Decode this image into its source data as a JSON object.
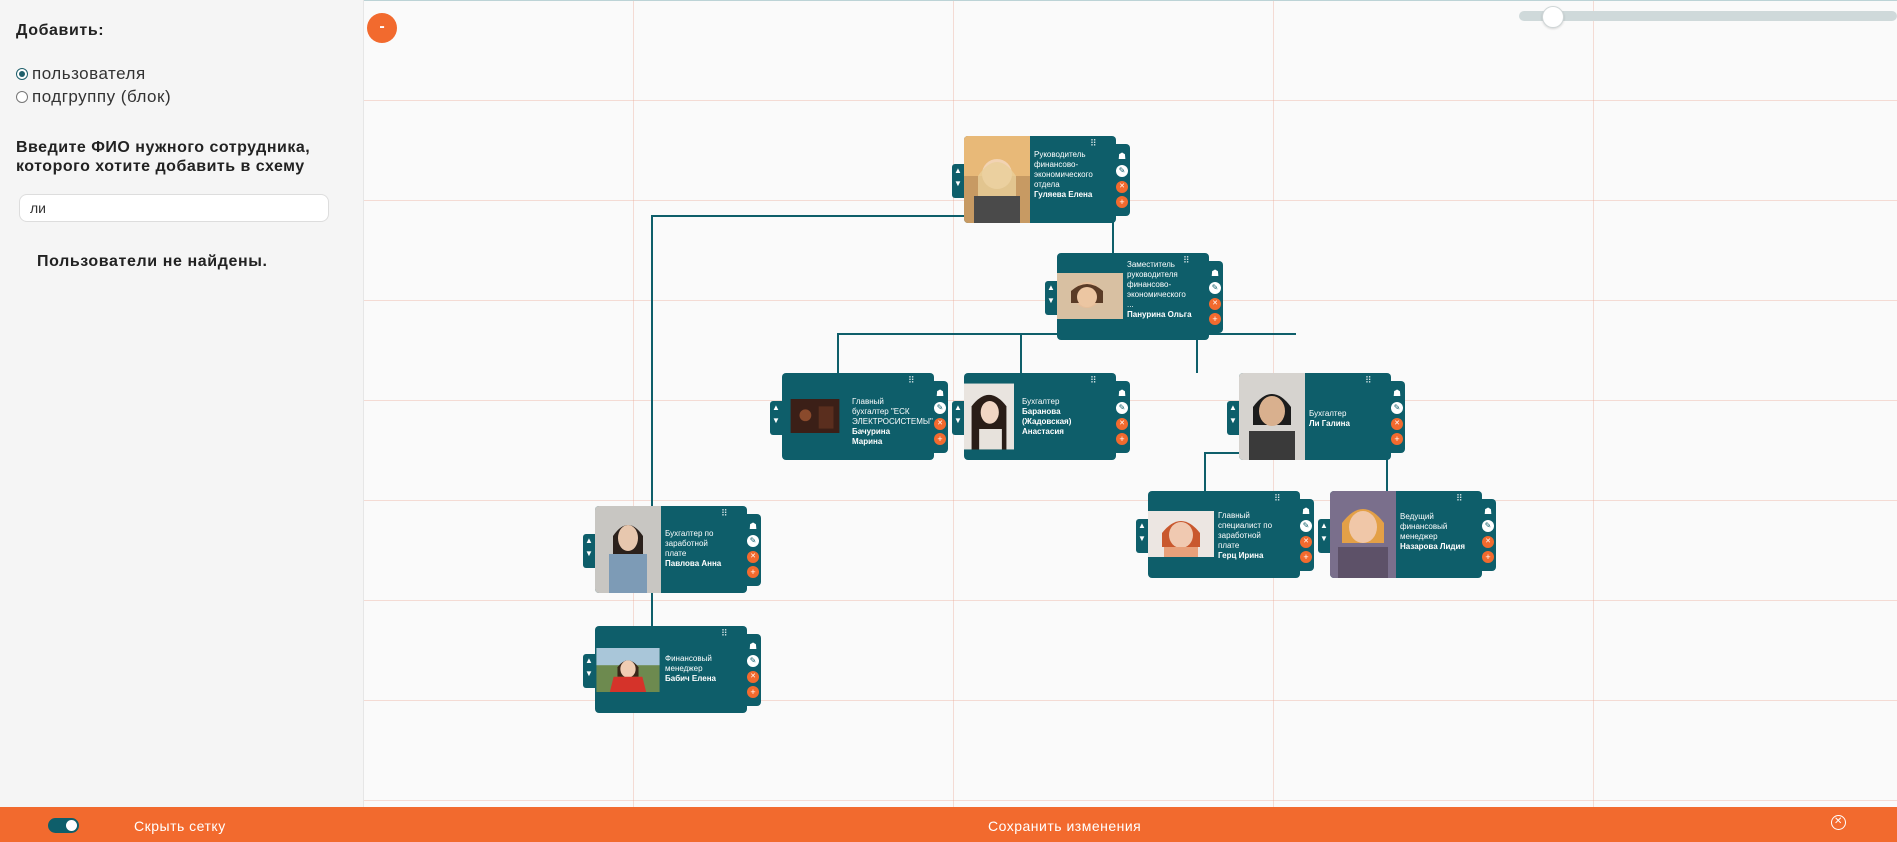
{
  "sidebar": {
    "title": "Добавить:",
    "options": [
      {
        "label": "пользователя",
        "checked": true
      },
      {
        "label": "подгруппу (блок)",
        "checked": false
      }
    ],
    "prompt": "Введите ФИО нужного сотрудника, которого хотите добавить в схему",
    "search_value": "ли",
    "empty_message": "Пользователи не найдены."
  },
  "toolbar": {
    "zoom_out_label": "-",
    "zoom_level": 0.42
  },
  "cards": [
    {
      "id": "gulyaeva",
      "position": "Руководитель финансово-экономического отдела",
      "name": "Гуляева Елена",
      "photo": "blonde-woman"
    },
    {
      "id": "panurina",
      "position": "Заместитель руководителя финансово-экономического ...",
      "name": "Панурина Ольга",
      "photo": "smiling-woman"
    },
    {
      "id": "bachurina",
      "position": "Главный бухгалтер \"ЕСК ЭЛЕКТРОСИСТЕМЫ\"",
      "name": "Бачурина Марина",
      "photo": "dark-photo"
    },
    {
      "id": "baranova",
      "position": "Бухгалтер",
      "name": "Баранова (Жадовская) Анастасия",
      "photo": "dark-hair-woman"
    },
    {
      "id": "li",
      "position": "Бухгалтер",
      "name": "Ли Галина",
      "photo": "woman-portrait"
    },
    {
      "id": "pavlova",
      "position": "Бухгалтер по заработной плате",
      "name": "Павлова Анна",
      "photo": "office-woman"
    },
    {
      "id": "gerts",
      "position": "Главный специалист по заработной плате",
      "name": "Герц Ирина",
      "photo": "redhead-woman"
    },
    {
      "id": "nazarova",
      "position": "Ведущий финансовый менеджер",
      "name": "Назарова Лидия",
      "photo": "blonde-woman-2"
    },
    {
      "id": "babich",
      "position": "Финансовый менеджер",
      "name": "Бабич Елена",
      "photo": "red-dress-woman"
    }
  ],
  "footer": {
    "hide_grid_label": "Скрыть сетку",
    "save_label": "Сохранить изменения",
    "grid_toggle_on": true
  },
  "colors": {
    "card": "#0e5e6a",
    "accent": "#f26a2e"
  },
  "icons": [
    "hierarchy-icon",
    "edit-icon",
    "delete-icon",
    "add-icon",
    "move-up-icon",
    "move-down-icon",
    "drag-handle-icon",
    "close-icon"
  ]
}
